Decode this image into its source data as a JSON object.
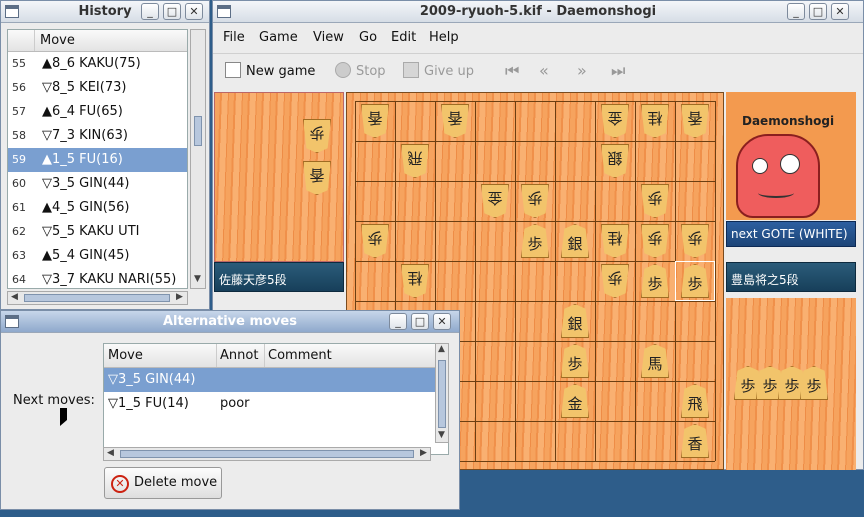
{
  "history": {
    "title": "History",
    "column_header": "Move",
    "rows": [
      {
        "num": "55",
        "move": "▲8_6 KAKU(75)"
      },
      {
        "num": "56",
        "move": "▽8_5 KEI(73)"
      },
      {
        "num": "57",
        "move": "▲6_4 FU(65)"
      },
      {
        "num": "58",
        "move": "▽7_3 KIN(63)"
      },
      {
        "num": "59",
        "move": "▲1_5 FU(16)"
      },
      {
        "num": "60",
        "move": "▽3_5 GIN(44)"
      },
      {
        "num": "61",
        "move": "▲4_5 GIN(56)"
      },
      {
        "num": "62",
        "move": "▽5_5 KAKU UTI"
      },
      {
        "num": "63",
        "move": "▲5_4 GIN(45)"
      },
      {
        "num": "64",
        "move": "▽3_7 KAKU NARI(55)"
      }
    ],
    "selected_index": 4
  },
  "main": {
    "title": "2009-ryuoh-5.kif - Daemonshogi",
    "menu": [
      "File",
      "Game",
      "View",
      "Go",
      "Edit",
      "Help"
    ],
    "toolbar": {
      "new_game": "New game",
      "stop": "Stop",
      "give_up": "Give up"
    },
    "player_left": "佐藤天彦5段",
    "player_right": "豊島将之5段",
    "next_turn": "next GOTE (WHITE)",
    "avatar_label": "Daemonshogi",
    "captured_left": [
      "歩",
      "香"
    ],
    "captured_right": [
      "歩",
      "歩",
      "歩",
      "歩"
    ]
  },
  "board": {
    "pieces": [
      {
        "f": 9,
        "r": 1,
        "c": "香",
        "g": true
      },
      {
        "f": 7,
        "r": 1,
        "c": "香",
        "g": true
      },
      {
        "f": 3,
        "r": 1,
        "c": "金",
        "g": true
      },
      {
        "f": 2,
        "r": 1,
        "c": "桂",
        "g": true
      },
      {
        "f": 1,
        "r": 1,
        "c": "香",
        "g": true
      },
      {
        "f": 8,
        "r": 2,
        "c": "飛",
        "g": true
      },
      {
        "f": 3,
        "r": 2,
        "c": "銀",
        "g": true
      },
      {
        "f": 6,
        "r": 3,
        "c": "金",
        "g": true
      },
      {
        "f": 5,
        "r": 3,
        "c": "歩",
        "g": true
      },
      {
        "f": 2,
        "r": 3,
        "c": "歩",
        "g": true
      },
      {
        "f": 9,
        "r": 4,
        "c": "歩",
        "g": true
      },
      {
        "f": 5,
        "r": 4,
        "c": "歩",
        "g": false
      },
      {
        "f": 4,
        "r": 4,
        "c": "銀",
        "g": false
      },
      {
        "f": 3,
        "r": 4,
        "c": "桂",
        "g": true
      },
      {
        "f": 2,
        "r": 4,
        "c": "歩",
        "g": true
      },
      {
        "f": 1,
        "r": 4,
        "c": "歩",
        "g": true
      },
      {
        "f": 8,
        "r": 5,
        "c": "桂",
        "g": true
      },
      {
        "f": 3,
        "r": 5,
        "c": "歩",
        "g": true
      },
      {
        "f": 2,
        "r": 5,
        "c": "歩",
        "g": false
      },
      {
        "f": 1,
        "r": 5,
        "c": "歩",
        "g": false
      },
      {
        "f": 4,
        "r": 6,
        "c": "銀",
        "g": false
      },
      {
        "f": 4,
        "r": 7,
        "c": "歩",
        "g": false
      },
      {
        "f": 2,
        "r": 7,
        "c": "馬",
        "g": false
      },
      {
        "f": 4,
        "r": 8,
        "c": "金",
        "g": false
      },
      {
        "f": 1,
        "r": 8,
        "c": "飛",
        "g": false
      },
      {
        "f": 1,
        "r": 9,
        "c": "香",
        "g": false
      }
    ],
    "highlight": {
      "f": 1,
      "r": 5
    }
  },
  "alt": {
    "title": "Alternative moves",
    "next_label": "Next moves:",
    "headers": {
      "move": "Move",
      "annot": "Annot",
      "comment": "Comment"
    },
    "rows": [
      {
        "move": "▽3_5 GIN(44)",
        "annot": "",
        "comment": ""
      },
      {
        "move": "▽1_5 FU(14)",
        "annot": "poor",
        "comment": ""
      }
    ],
    "delete_label": "Delete move"
  }
}
